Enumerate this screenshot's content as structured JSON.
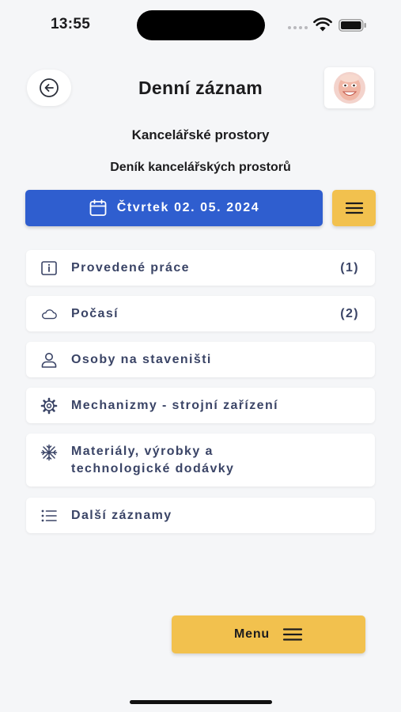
{
  "status_bar": {
    "time": "13:55"
  },
  "header": {
    "title": "Denní záznam"
  },
  "project": {
    "name": "Kancelářské prostory",
    "diary": "Deník kancelářských prostorů"
  },
  "date_button": {
    "label": "Čtvrtek 02. 05. 2024"
  },
  "items": [
    {
      "label": "Provedené práce",
      "count": "(1)",
      "icon": "info-icon"
    },
    {
      "label": "Počasí",
      "count": "(2)",
      "icon": "cloud-icon"
    },
    {
      "label": "Osoby na staveništi",
      "count": "",
      "icon": "person-icon"
    },
    {
      "label": "Mechanizmy - strojní zařízení",
      "count": "",
      "icon": "gear-icon"
    },
    {
      "label": "Materiály, výrobky a",
      "label2": "technologické dodávky",
      "count": "",
      "icon": "materials-icon"
    },
    {
      "label": "Další záznamy",
      "count": "",
      "icon": "list-icon"
    }
  ],
  "menu_button": {
    "label": "Menu"
  },
  "colors": {
    "primary": "#2f5ecf",
    "accent": "#f2c14e",
    "text_muted": "#3a4466"
  }
}
